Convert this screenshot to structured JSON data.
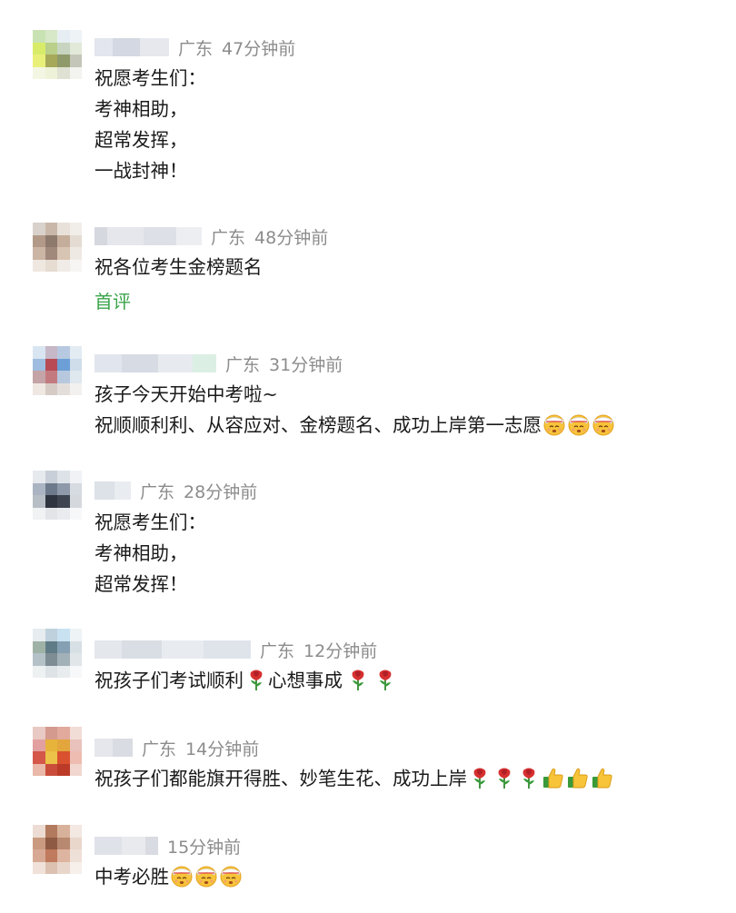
{
  "comments": [
    {
      "location": "广东",
      "time": "47分钟前",
      "lines": [
        "祝愿考生们：",
        "考神相助，",
        "超常发挥，",
        "一战封神！"
      ]
    },
    {
      "location": "广东",
      "time": "48分钟前",
      "lines": [
        "祝各位考生金榜题名"
      ],
      "first_comment_badge": "首评"
    },
    {
      "location": "广东",
      "time": "31分钟前",
      "lines": [
        "孩子今天开始中考啦~",
        "祝顺顺利利、从容应对、金榜题名、成功上岸第一志愿"
      ],
      "emoji": [
        "bandaged-face-emoji",
        "bandaged-face-emoji",
        "bandaged-face-emoji"
      ]
    },
    {
      "location": "广东",
      "time": "28分钟前",
      "lines": [
        "祝愿考生们：",
        "考神相助，",
        "超常发挥！"
      ]
    },
    {
      "location": "广东",
      "time": "12分钟前",
      "lines": [
        "祝孩子们考试顺利",
        "心想事成"
      ],
      "emoji": [
        "rose-emoji",
        "rose-emoji",
        "rose-emoji"
      ]
    },
    {
      "location": "广东",
      "time": "14分钟前",
      "lines": [
        "祝孩子们都能旗开得胜、妙笔生花、成功上岸"
      ],
      "emoji": [
        "rose-emoji",
        "rose-emoji",
        "rose-emoji",
        "thumbs-up-emoji",
        "thumbs-up-emoji",
        "thumbs-up-emoji"
      ]
    },
    {
      "time": "15分钟前",
      "lines": [
        "中考必胜"
      ],
      "emoji": [
        "bandaged-face-emoji",
        "bandaged-face-emoji",
        "bandaged-face-emoji"
      ]
    }
  ],
  "colors": {
    "meta_text": "#8c8c8c",
    "body_text": "#1a1a1a",
    "first_comment_badge": "#3aa44b",
    "background": "#ffffff"
  }
}
